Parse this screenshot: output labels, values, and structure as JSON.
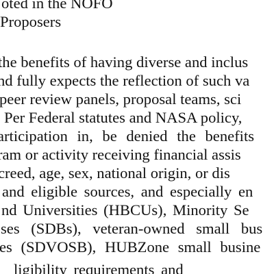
{
  "document": {
    "lines": [
      "oted in the NOFO",
      "Proposers",
      "",
      "the benefits of having diverse and inclus",
      "nd fully expects the reflection of such va",
      " peer review panels, proposal teams, sci",
      "Per Federal statutes and NASA policy, ",
      "articipation in, be denied the benefits",
      "ram or activity receiving financial assis",
      "creed, age, sex, national origin, or dis",
      "and eligible sources, and especially en",
      "nd Universities (HBCUs), Minority Se",
      "ses (SDBs), veteran-owned small bus",
      "es (SDVOSB), HUBZone small busine",
      "ligibility requirements and"
    ]
  }
}
